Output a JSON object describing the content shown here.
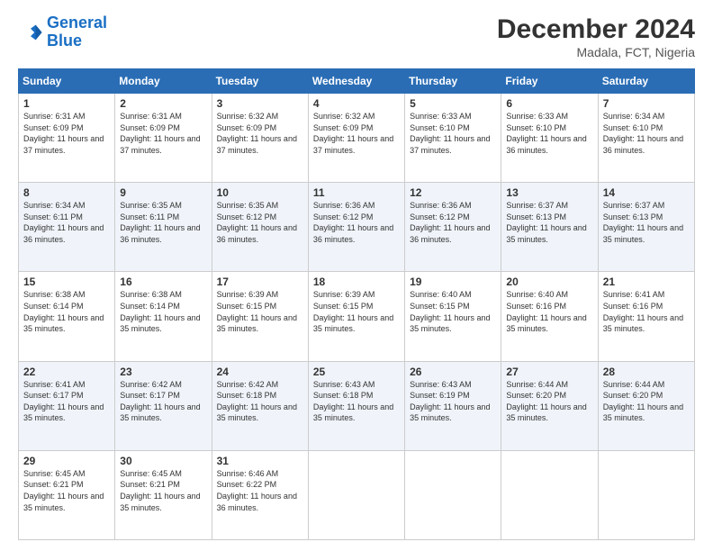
{
  "logo": {
    "line1": "General",
    "line2": "Blue"
  },
  "title": "December 2024",
  "subtitle": "Madala, FCT, Nigeria",
  "days_header": [
    "Sunday",
    "Monday",
    "Tuesday",
    "Wednesday",
    "Thursday",
    "Friday",
    "Saturday"
  ],
  "weeks": [
    [
      {
        "day": "1",
        "sunrise": "6:31 AM",
        "sunset": "6:09 PM",
        "daylight": "11 hours and 37 minutes."
      },
      {
        "day": "2",
        "sunrise": "6:31 AM",
        "sunset": "6:09 PM",
        "daylight": "11 hours and 37 minutes."
      },
      {
        "day": "3",
        "sunrise": "6:32 AM",
        "sunset": "6:09 PM",
        "daylight": "11 hours and 37 minutes."
      },
      {
        "day": "4",
        "sunrise": "6:32 AM",
        "sunset": "6:09 PM",
        "daylight": "11 hours and 37 minutes."
      },
      {
        "day": "5",
        "sunrise": "6:33 AM",
        "sunset": "6:10 PM",
        "daylight": "11 hours and 37 minutes."
      },
      {
        "day": "6",
        "sunrise": "6:33 AM",
        "sunset": "6:10 PM",
        "daylight": "11 hours and 36 minutes."
      },
      {
        "day": "7",
        "sunrise": "6:34 AM",
        "sunset": "6:10 PM",
        "daylight": "11 hours and 36 minutes."
      }
    ],
    [
      {
        "day": "8",
        "sunrise": "6:34 AM",
        "sunset": "6:11 PM",
        "daylight": "11 hours and 36 minutes."
      },
      {
        "day": "9",
        "sunrise": "6:35 AM",
        "sunset": "6:11 PM",
        "daylight": "11 hours and 36 minutes."
      },
      {
        "day": "10",
        "sunrise": "6:35 AM",
        "sunset": "6:12 PM",
        "daylight": "11 hours and 36 minutes."
      },
      {
        "day": "11",
        "sunrise": "6:36 AM",
        "sunset": "6:12 PM",
        "daylight": "11 hours and 36 minutes."
      },
      {
        "day": "12",
        "sunrise": "6:36 AM",
        "sunset": "6:12 PM",
        "daylight": "11 hours and 36 minutes."
      },
      {
        "day": "13",
        "sunrise": "6:37 AM",
        "sunset": "6:13 PM",
        "daylight": "11 hours and 35 minutes."
      },
      {
        "day": "14",
        "sunrise": "6:37 AM",
        "sunset": "6:13 PM",
        "daylight": "11 hours and 35 minutes."
      }
    ],
    [
      {
        "day": "15",
        "sunrise": "6:38 AM",
        "sunset": "6:14 PM",
        "daylight": "11 hours and 35 minutes."
      },
      {
        "day": "16",
        "sunrise": "6:38 AM",
        "sunset": "6:14 PM",
        "daylight": "11 hours and 35 minutes."
      },
      {
        "day": "17",
        "sunrise": "6:39 AM",
        "sunset": "6:15 PM",
        "daylight": "11 hours and 35 minutes."
      },
      {
        "day": "18",
        "sunrise": "6:39 AM",
        "sunset": "6:15 PM",
        "daylight": "11 hours and 35 minutes."
      },
      {
        "day": "19",
        "sunrise": "6:40 AM",
        "sunset": "6:15 PM",
        "daylight": "11 hours and 35 minutes."
      },
      {
        "day": "20",
        "sunrise": "6:40 AM",
        "sunset": "6:16 PM",
        "daylight": "11 hours and 35 minutes."
      },
      {
        "day": "21",
        "sunrise": "6:41 AM",
        "sunset": "6:16 PM",
        "daylight": "11 hours and 35 minutes."
      }
    ],
    [
      {
        "day": "22",
        "sunrise": "6:41 AM",
        "sunset": "6:17 PM",
        "daylight": "11 hours and 35 minutes."
      },
      {
        "day": "23",
        "sunrise": "6:42 AM",
        "sunset": "6:17 PM",
        "daylight": "11 hours and 35 minutes."
      },
      {
        "day": "24",
        "sunrise": "6:42 AM",
        "sunset": "6:18 PM",
        "daylight": "11 hours and 35 minutes."
      },
      {
        "day": "25",
        "sunrise": "6:43 AM",
        "sunset": "6:18 PM",
        "daylight": "11 hours and 35 minutes."
      },
      {
        "day": "26",
        "sunrise": "6:43 AM",
        "sunset": "6:19 PM",
        "daylight": "11 hours and 35 minutes."
      },
      {
        "day": "27",
        "sunrise": "6:44 AM",
        "sunset": "6:20 PM",
        "daylight": "11 hours and 35 minutes."
      },
      {
        "day": "28",
        "sunrise": "6:44 AM",
        "sunset": "6:20 PM",
        "daylight": "11 hours and 35 minutes."
      }
    ],
    [
      {
        "day": "29",
        "sunrise": "6:45 AM",
        "sunset": "6:21 PM",
        "daylight": "11 hours and 35 minutes."
      },
      {
        "day": "30",
        "sunrise": "6:45 AM",
        "sunset": "6:21 PM",
        "daylight": "11 hours and 35 minutes."
      },
      {
        "day": "31",
        "sunrise": "6:46 AM",
        "sunset": "6:22 PM",
        "daylight": "11 hours and 36 minutes."
      },
      null,
      null,
      null,
      null
    ]
  ]
}
